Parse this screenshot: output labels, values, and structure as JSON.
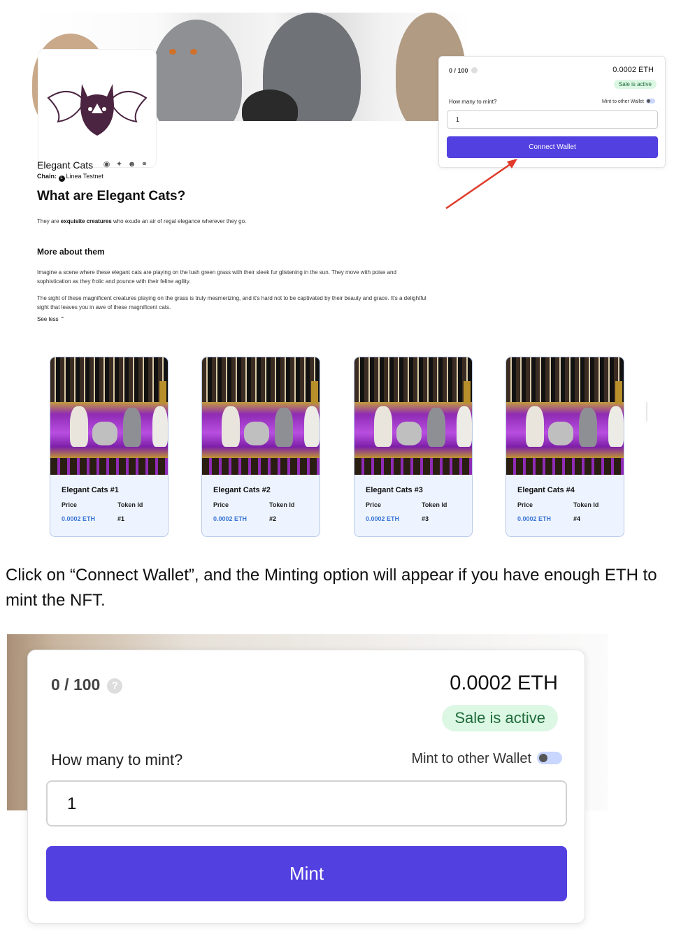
{
  "top": {
    "mint_card": {
      "supply": "0 / 100",
      "price": "0.0002 ETH",
      "status": "Sale is active",
      "quantity_label": "How many to mint?",
      "other_wallet_label": "Mint to other Wallet",
      "quantity_value": "1",
      "button_label": "Connect Wallet"
    },
    "collection": {
      "name": "Elegant Cats",
      "chain_label": "Chain:",
      "chain_name": "Linea Testnet",
      "heading": "What are Elegant Cats?",
      "intro_before": "They are ",
      "intro_bold": "exquisite creatures",
      "intro_after": " who exude an air of regal elegance wherever they go.",
      "more_heading": "More about them",
      "paragraph1": "Imagine a scene where these elegant cats are playing on the lush green grass with their sleek fur glistening in the sun. They move with poise and sophistication as they frolic and pounce with their feline agility.",
      "paragraph2": "The sight of these magnificent creatures playing on the grass is truly mesmerizing, and it's hard not to be captivated by their beauty and grace. It's a delightful sight that leaves you in awe of these magnificent cats.",
      "see_less": "See less"
    },
    "nfts": [
      {
        "title": "Elegant Cats #1",
        "price_label": "Price",
        "price": "0.0002 ETH",
        "token_label": "Token Id",
        "token": "#1"
      },
      {
        "title": "Elegant Cats #2",
        "price_label": "Price",
        "price": "0.0002 ETH",
        "token_label": "Token Id",
        "token": "#2"
      },
      {
        "title": "Elegant Cats #3",
        "price_label": "Price",
        "price": "0.0002 ETH",
        "token_label": "Token Id",
        "token": "#3"
      },
      {
        "title": "Elegant Cats #4",
        "price_label": "Price",
        "price": "0.0002 ETH",
        "token_label": "Token Id",
        "token": "#4"
      }
    ]
  },
  "caption": "Click on “Connect Wallet”, and the Minting option will appear if you have enough ETH to mint the NFT.",
  "zoom": {
    "supply": "0 / 100",
    "help_glyph": "?",
    "price": "0.0002 ETH",
    "status": "Sale is active",
    "quantity_label": "How many to mint?",
    "other_wallet_label": "Mint to other Wallet",
    "quantity_value": "1",
    "button_label": "Mint"
  },
  "colors": {
    "accent": "#5340e0",
    "status_bg": "#dcf7e4",
    "status_text": "#1f6b3a",
    "price_link": "#3b77d8",
    "arrow": "#e03a2a"
  }
}
